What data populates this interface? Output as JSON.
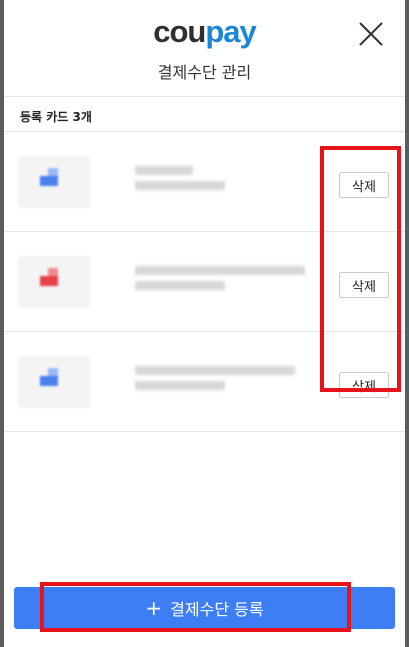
{
  "header": {
    "logo_part1": "cou",
    "logo_part2": "pay",
    "title": "결제수단 관리",
    "close_icon": "close-icon"
  },
  "cards_section": {
    "label": "등록 카드 3개",
    "cards": [
      {
        "thumb_color": "#4a7ff0",
        "delete_label": "삭제"
      },
      {
        "thumb_color": "#e8404a",
        "delete_label": "삭제"
      },
      {
        "thumb_color": "#4a7ff0",
        "delete_label": "삭제"
      }
    ]
  },
  "footer": {
    "plus_icon": "plus-icon",
    "register_label": "결제수단 등록"
  },
  "colors": {
    "primary_button": "#3d7ef5",
    "logo_dark": "#2f2f2f",
    "logo_blue": "#1a86d6",
    "highlight": "#e8121a"
  }
}
